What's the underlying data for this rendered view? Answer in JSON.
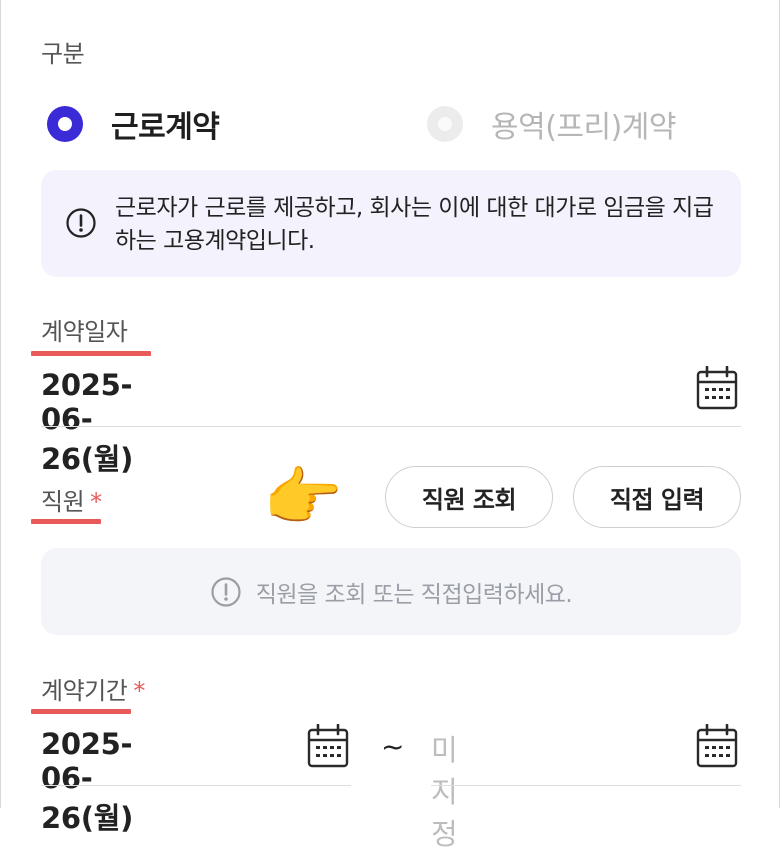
{
  "category": {
    "label": "구분",
    "options": [
      {
        "label": "근로계약",
        "selected": true
      },
      {
        "label": "용역(프리)계약",
        "selected": false
      }
    ],
    "info": "근로자가 근로를 제공하고, 회사는 이에 대한 대가로 임금을 지급하는 고용계약입니다."
  },
  "contract_date": {
    "label": "계약일자",
    "value": "2025-06-26(월)"
  },
  "employee": {
    "label": "직원",
    "required_mark": "*",
    "hand_emoji": "👉",
    "lookup_button": "직원 조회",
    "manual_button": "직접 입력",
    "empty_message": "직원을 조회 또는 직접입력하세요."
  },
  "contract_period": {
    "label": "계약기간",
    "required_mark": "*",
    "start_value": "2025-06-26(월)",
    "separator": "~",
    "end_placeholder": "미지정"
  },
  "colors": {
    "accent": "#3b2bd6",
    "required": "#e85a5a",
    "info_bg": "#f4f3fd",
    "empty_bg": "#f4f5f8"
  }
}
